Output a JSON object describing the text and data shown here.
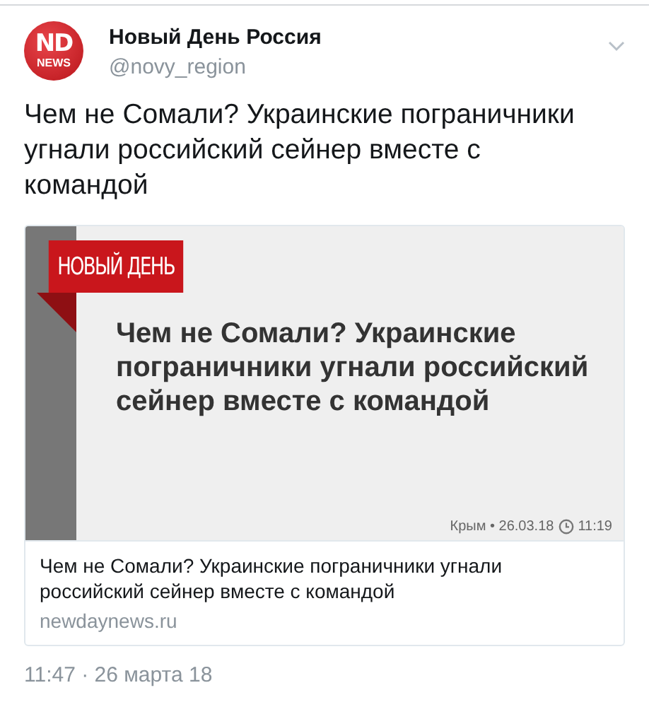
{
  "author": {
    "logo_top": "ND",
    "logo_bottom": "NEWS",
    "name": "Новый День Россия",
    "handle": "@novy_region"
  },
  "tweet_text": "Чем не Сомали? Украинские пограничники угнали российский сейнер вместе с командой",
  "card": {
    "banner": "НОВЫЙ ДЕНЬ",
    "image_headline": "Чем не Сомали? Украинские пограничники угнали российский сейнер вместе с командой",
    "image_region": "Крым • 26.03.18",
    "image_time": "11:19",
    "title": "Чем не Сомали? Украинские пограничники угнали российский сейнер вместе с командой",
    "domain": "newdaynews.ru"
  },
  "timestamp": "11:47 · 26 марта 18"
}
